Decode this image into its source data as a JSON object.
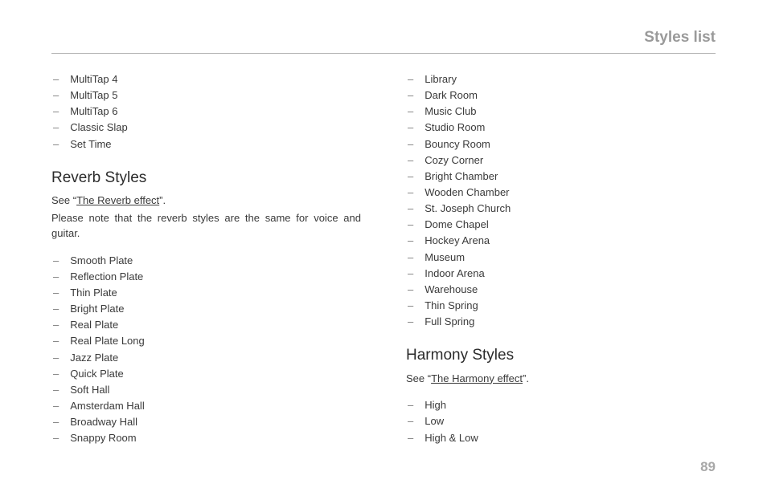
{
  "header": {
    "title": "Styles list"
  },
  "page_number": "89",
  "col_left": {
    "top_list": [
      "MultiTap 4",
      "MultiTap 5",
      "MultiTap 6",
      "Classic Slap",
      "Set Time"
    ],
    "reverb": {
      "heading": "Reverb Styles",
      "see_pre": "See “",
      "see_link": "The Reverb effect",
      "see_post": "”.",
      "note": "Please note that the reverb styles are the same for voice and guitar.",
      "items": [
        "Smooth Plate",
        "Reflection Plate",
        "Thin Plate",
        "Bright Plate",
        "Real Plate",
        "Real Plate Long",
        "Jazz Plate",
        "Quick Plate",
        "Soft Hall",
        "Amsterdam Hall",
        "Broadway Hall",
        "Snappy Room"
      ]
    }
  },
  "col_right": {
    "reverb_cont": [
      "Library",
      "Dark Room",
      "Music Club",
      "Studio Room",
      "Bouncy Room",
      "Cozy Corner",
      "Bright Chamber",
      "Wooden Chamber",
      "St. Joseph Church",
      "Dome Chapel",
      "Hockey Arena",
      "Museum",
      "Indoor Arena",
      "Warehouse",
      "Thin Spring",
      "Full Spring"
    ],
    "harmony": {
      "heading": "Harmony Styles",
      "see_pre": "See “",
      "see_link": "The Harmony effect",
      "see_post": "”.",
      "items": [
        "High",
        "Low",
        "High & Low"
      ]
    }
  }
}
